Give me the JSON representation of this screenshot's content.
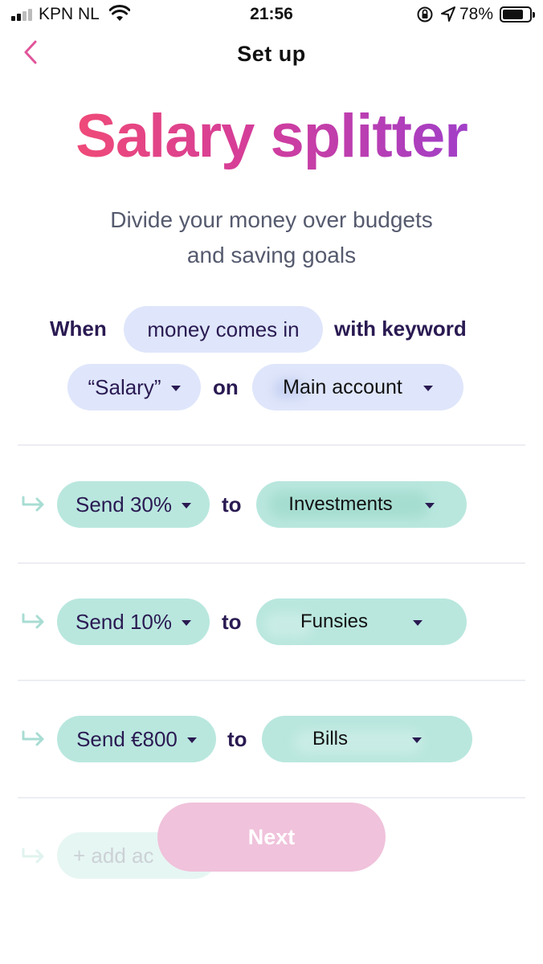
{
  "status": {
    "carrier": "KPN NL",
    "time": "21:56",
    "battery": "78%",
    "battery_level": 0.78
  },
  "nav": {
    "title": "Set up",
    "back_icon": "chevron-left-icon"
  },
  "header": {
    "title": "Salary splitter",
    "subtitle_line1": "Divide your money over budgets",
    "subtitle_line2": "and saving goals"
  },
  "trigger": {
    "when_label": "When",
    "event": "money comes in",
    "keyword_label": "with keyword",
    "keyword": "“Salary”",
    "on_label": "on",
    "account": "Main account"
  },
  "rules": [
    {
      "amount": "Send 30%",
      "to_label": "to",
      "target": "Investments"
    },
    {
      "amount": "Send 10%",
      "to_label": "to",
      "target": "Funsies"
    },
    {
      "amount": "Send €800",
      "to_label": "to",
      "target": "Bills"
    }
  ],
  "add_account": "+ add ac",
  "next_button": "Next",
  "colors": {
    "accent_pink": "#ef4a78",
    "accent_purple": "#a13fc8",
    "pill_blue": "#dfe6fb",
    "pill_green": "#b9e7de",
    "next_button": "#f0c2db",
    "text_dark": "#2a1a52"
  }
}
